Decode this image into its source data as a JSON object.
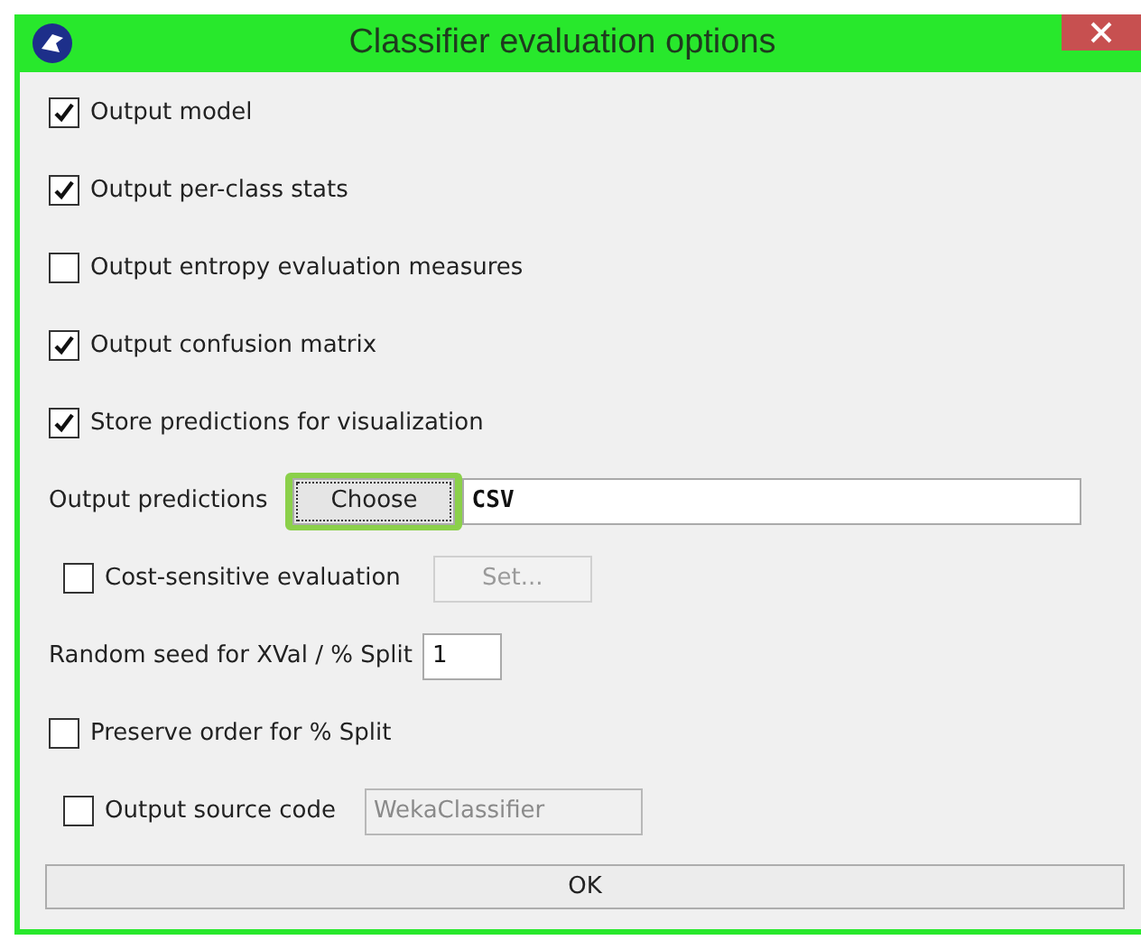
{
  "window": {
    "title": "Classifier evaluation options"
  },
  "rows": [
    {
      "kind": "checkbox",
      "label": "Output model",
      "checked": true
    },
    {
      "kind": "checkbox",
      "label": "Output per-class stats",
      "checked": true
    },
    {
      "kind": "checkbox",
      "label": "Output entropy evaluation measures",
      "checked": false
    },
    {
      "kind": "checkbox",
      "label": "Output confusion matrix",
      "checked": true
    },
    {
      "kind": "checkbox",
      "label": "Store predictions for visualization",
      "checked": true
    },
    {
      "kind": "chooser",
      "label": "Output predictions",
      "button": "Choose",
      "value": "CSV",
      "highlighted": true
    },
    {
      "kind": "checkbox-button",
      "label": "Cost-sensitive evaluation",
      "checked": false,
      "button": "Set...",
      "disabled": true
    },
    {
      "kind": "text-field",
      "label": "Random seed for XVal / % Split",
      "value": "1"
    },
    {
      "kind": "checkbox",
      "label": "Preserve order for % Split",
      "checked": false
    },
    {
      "kind": "checkbox-field",
      "label": "Output source code",
      "checked": false,
      "value": "WekaClassifier",
      "disabled": true
    }
  ],
  "ok_button": "OK"
}
